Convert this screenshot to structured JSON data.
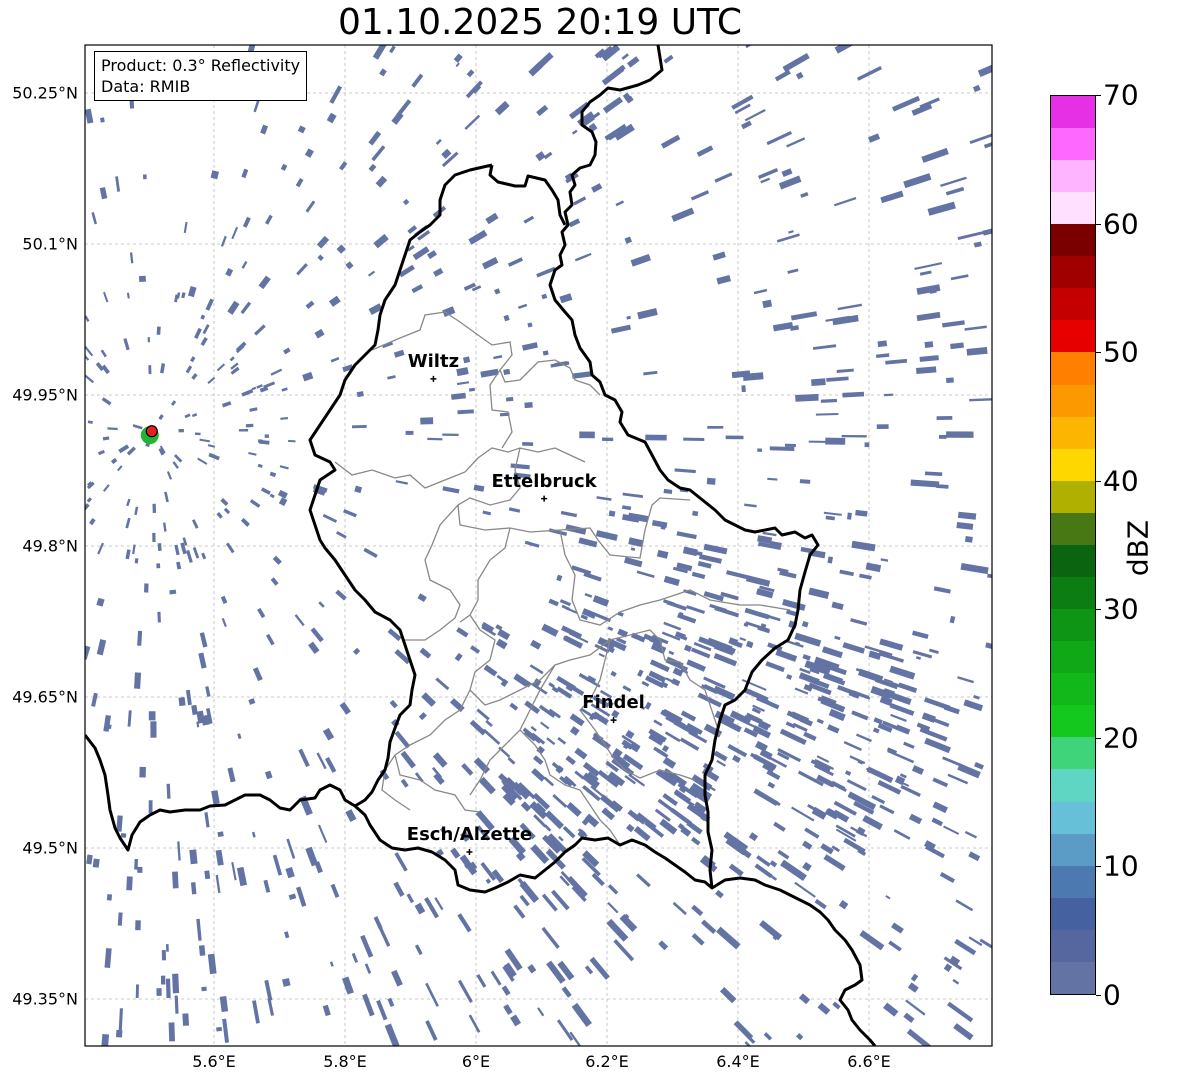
{
  "title": "01.10.2025 20:19 UTC",
  "info": {
    "product": "Product: 0.3° Reflectivity",
    "data": "Data: RMIB"
  },
  "map": {
    "lon_range": [
      5.4,
      6.8
    ],
    "lat_range": [
      49.3,
      50.3
    ],
    "lat_ticks": [
      {
        "lat": 50.25,
        "label": "50.25°N"
      },
      {
        "lat": 50.1,
        "label": "50.1°N"
      },
      {
        "lat": 49.95,
        "label": "49.95°N"
      },
      {
        "lat": 49.8,
        "label": "49.8°N"
      },
      {
        "lat": 49.65,
        "label": "49.65°N"
      },
      {
        "lat": 49.5,
        "label": "49.5°N"
      },
      {
        "lat": 49.35,
        "label": "49.35°N"
      }
    ],
    "lon_ticks": [
      {
        "lon": 5.6,
        "label": "5.6°E"
      },
      {
        "lon": 5.8,
        "label": "5.8°E"
      },
      {
        "lon": 6.0,
        "label": "6°E"
      },
      {
        "lon": 6.2,
        "label": "6.2°E"
      },
      {
        "lon": 6.4,
        "label": "6.4°E"
      },
      {
        "lon": 6.6,
        "label": "6.6°E"
      }
    ],
    "cities": [
      {
        "name": "Wiltz",
        "lon": 5.935,
        "lat": 49.966
      },
      {
        "name": "Ettelbruck",
        "lon": 6.104,
        "lat": 49.847
      },
      {
        "name": "Findel",
        "lon": 6.21,
        "lat": 49.627
      },
      {
        "name": "Esch/Alzette",
        "lon": 5.99,
        "lat": 49.496
      }
    ],
    "radar_site": {
      "lon": 5.505,
      "lat": 49.914
    },
    "echo_color": "#6373a3",
    "border_color": "#000000",
    "canton_color": "#888888"
  },
  "colorbar": {
    "label": "dBZ",
    "ticks": [
      "0",
      "10",
      "20",
      "30",
      "40",
      "50",
      "60",
      "70"
    ],
    "min": 0,
    "max": 70,
    "colors": [
      "#6373a3",
      "#5667a0",
      "#4661a0",
      "#4c7ab0",
      "#5a9cc6",
      "#66c0d8",
      "#5fd6c4",
      "#40d47a",
      "#14c81e",
      "#12b81a",
      "#11a818",
      "#0f9516",
      "#0c7d13",
      "#0a6410",
      "#477813",
      "#b0b000",
      "#ffd700",
      "#fcb500",
      "#fc9800",
      "#ff7f00",
      "#e60000",
      "#c40000",
      "#a00000",
      "#7a0000",
      "#ffe0ff",
      "#ffb4ff",
      "#ff68ff",
      "#e630e6"
    ]
  }
}
